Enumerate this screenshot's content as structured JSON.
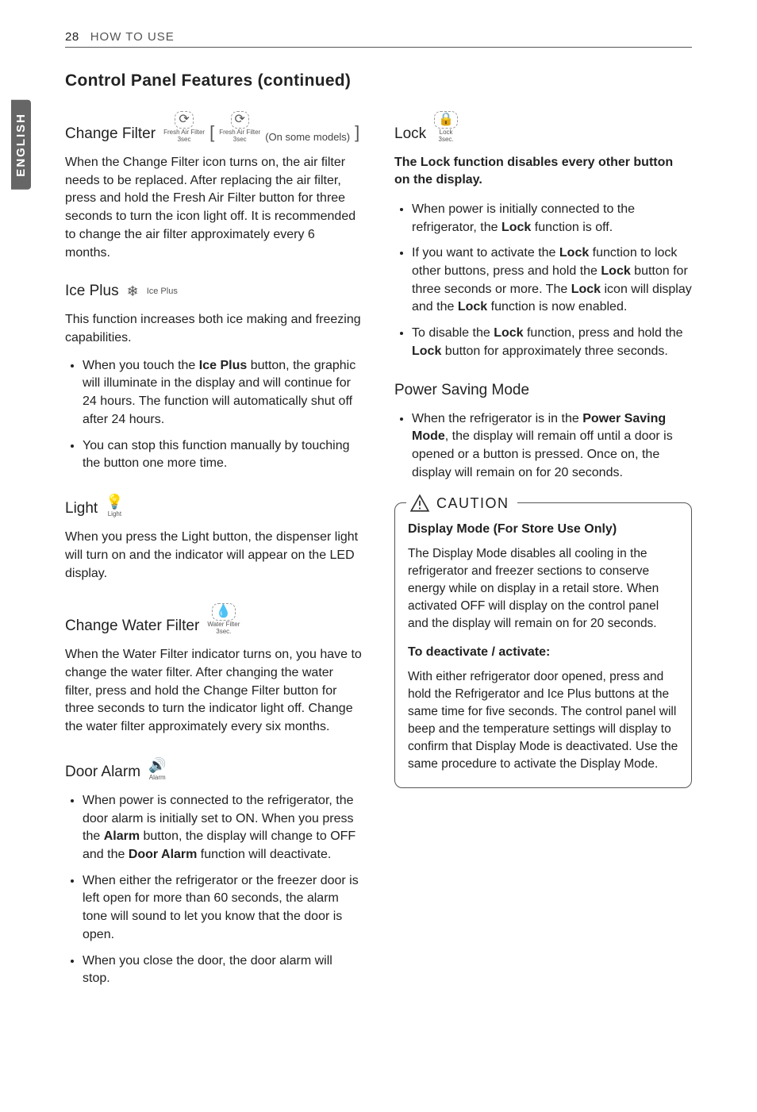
{
  "header": {
    "pageNumber": "28",
    "sectionName": "HOW TO USE"
  },
  "sideTab": "ENGLISH",
  "title": "Control Panel Features (continued)",
  "left": {
    "changeFilter": {
      "heading": "Change Filter",
      "iconLabel1": "Fresh Air Filter",
      "iconSub1": "3sec",
      "iconLabel2": "Fresh Air Filter",
      "iconSub2": "3sec",
      "modelsNote": "(On some models)",
      "body": "When the Change Filter icon turns on, the air filter needs to be replaced. After replacing the air filter, press and hold the Fresh Air Filter button for three seconds to turn the icon light off. It is recommended to change the air filter approximately every 6 months."
    },
    "icePlus": {
      "heading": "Ice Plus",
      "iconLabel": "Ice Plus",
      "body": "This function increases both ice making and freezing capabilities.",
      "bullets": [
        {
          "pre": "When you touch the ",
          "bold": "Ice Plus",
          "post": " button, the graphic will illuminate in the display and will continue for 24 hours. The function will automatically shut off after 24 hours."
        },
        {
          "pre": "You can stop this function manually by touching the button one more time.",
          "bold": "",
          "post": ""
        }
      ]
    },
    "light": {
      "heading": "Light",
      "iconLabel": "Light",
      "body": "When you press the Light button, the dispenser light will turn on and the indicator will appear on the LED display."
    },
    "changeWaterFilter": {
      "heading": "Change Water Filter",
      "iconLabel": "Water Filter",
      "iconSub": "3sec.",
      "body": "When the Water Filter indicator turns on, you have to change the water filter. After changing the water filter, press and hold the Change Filter button for three seconds to turn the indicator light off. Change the water filter approximately every six months."
    },
    "doorAlarm": {
      "heading": "Door Alarm",
      "iconLabel": "Alarm",
      "bullets": [
        {
          "pre": "When power is connected to the refrigerator, the door alarm is initially set to ON. When you press the ",
          "bold1": "Alarm",
          "mid": " button, the display will change to OFF and the ",
          "bold2": "Door Alarm",
          "post": " function will deactivate."
        },
        {
          "text": "When either the refrigerator or the freezer door is left open for more than 60 seconds, the alarm tone will sound to let you know that the door is open."
        },
        {
          "text": "When you close the door, the door alarm will stop."
        }
      ]
    }
  },
  "right": {
    "lock": {
      "heading": "Lock",
      "iconLabel": "Lock",
      "iconSub": "3sec.",
      "intro": "The Lock function disables every other button on the display.",
      "bullets": [
        {
          "pre": "When power is initially connected to the refrigerator, the ",
          "bold": "Lock",
          "post": " function is off."
        },
        {
          "pre": "If you want to activate the ",
          "b1": "Lock",
          "m1": " function to lock other buttons, press and hold the ",
          "b2": "Lock",
          "m2": " button for three seconds or more. The ",
          "b3": "Lock",
          "m3": " icon will display and the ",
          "b4": "Lock",
          "post": " function is now enabled."
        },
        {
          "pre": "To disable the ",
          "b1": "Lock",
          "m1": " function, press and hold the ",
          "b2": "Lock",
          "post": "  button for approximately three seconds."
        }
      ]
    },
    "powerSaving": {
      "heading": "Power Saving Mode",
      "bullet": {
        "pre": "When the refrigerator is in the ",
        "bold": "Power Saving Mode",
        "post": ", the display will remain off until a door is opened or a button is pressed. Once on, the display will remain on for 20 seconds."
      }
    },
    "caution": {
      "label": "CAUTION",
      "sub1": "Display Mode (For Store Use Only)",
      "body1": "The Display Mode disables all cooling in the refrigerator and freezer sections to conserve energy while on display in a retail store. When activated OFF will display on the control panel and the display will remain on for 20 seconds.",
      "sub2": "To deactivate / activate:",
      "body2": "With either refrigerator door opened, press and hold the Refrigerator and Ice Plus buttons at the same time for five seconds. The control panel will beep and the temperature settings will display to confirm that Display Mode is deactivated. Use the same procedure to activate the Display Mode."
    }
  }
}
